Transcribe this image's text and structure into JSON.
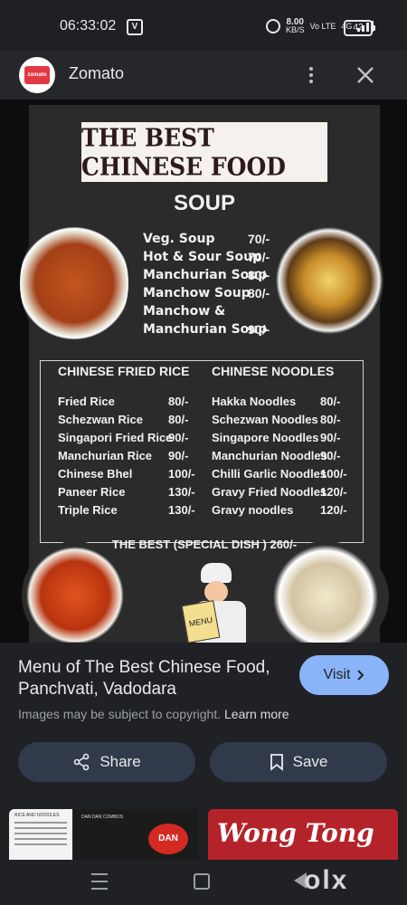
{
  "status_bar": {
    "time": "06:33:02",
    "net_speed": "8.00",
    "net_speed_unit": "KB/S",
    "network": "4G",
    "volte": "Vo LTE",
    "battery": "42"
  },
  "app_bar": {
    "logo_text": "zomato",
    "title": "Zomato"
  },
  "menu_image": {
    "title": "THE BEST CHINESE FOOD",
    "soup": {
      "heading": "SOUP",
      "items": [
        "Veg. Soup",
        "Hot & Sour Soup",
        "Manchurian Soup",
        "Manchow Soup",
        "Manchow &",
        "Manchurian Soup"
      ],
      "prices": [
        "70/-",
        "70/-",
        "80/-",
        "80/-",
        "",
        "90/-"
      ]
    },
    "fried_rice": {
      "heading": "CHINESE FRIED RICE",
      "items": [
        "Fried Rice",
        "Schezwan Rice",
        "Singapori Fried Rice",
        "Manchurian Rice",
        "Chinese Bhel",
        "Paneer Rice",
        "Triple Rice"
      ],
      "prices": [
        "80/-",
        "80/-",
        "90/-",
        "90/-",
        "100/-",
        "130/-",
        "130/-"
      ]
    },
    "noodles": {
      "heading": "CHINESE NOODLES",
      "items": [
        "Hakka Noodles",
        "Schezwan Noodles",
        "Singapore Noodles",
        "Manchurian Noodles",
        "Chilli Garlic Noodles",
        "Gravy Fried Noodles",
        "Gravy noodles"
      ],
      "prices": [
        "80/-",
        "80/-",
        "90/-",
        "90/-",
        "100/-",
        "120/-",
        "120/-"
      ]
    },
    "special": "THE BEST (SPECIAL DISH ) 260/-",
    "chef_card": "MENU"
  },
  "info": {
    "title": "Menu of The Best Chinese Food, Panchvati, Vadodara",
    "visit_label": "Visit",
    "copyright_text": "Images may be subject to copyright.",
    "learn_more": "Learn more",
    "share_label": "Share",
    "save_label": "Save"
  },
  "related": {
    "thumb1_title": "RICE AND NOODLES",
    "thumb2_title": "DAN DAN COMBOS",
    "thumb2_badge": "DAN DAN",
    "thumb3_text": "Wong Tong",
    "watermark": "olx"
  },
  "colors": {
    "accent": "#8ab4f8",
    "button_bg": "#303a4a",
    "zomato_red": "#e23744"
  },
  "icons": [
    "alarm-icon",
    "signal-icon",
    "battery-icon",
    "more-vert-icon",
    "close-icon",
    "lens-icon",
    "chevron-right-icon",
    "share-icon",
    "bookmark-icon",
    "recent-apps-icon",
    "home-icon",
    "back-icon"
  ]
}
